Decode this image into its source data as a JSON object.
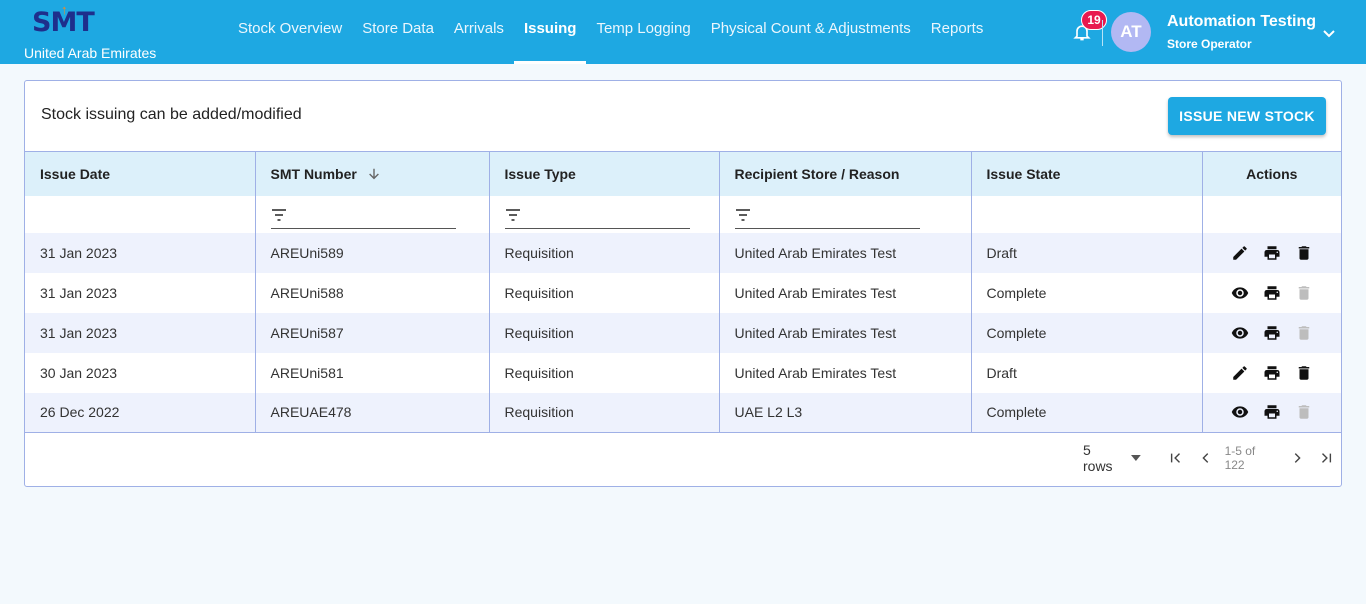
{
  "header": {
    "logo_text": "SMT",
    "country": "United Arab Emirates",
    "nav": [
      {
        "label": "Stock Overview",
        "active": false
      },
      {
        "label": "Store Data",
        "active": false
      },
      {
        "label": "Arrivals",
        "active": false
      },
      {
        "label": "Issuing",
        "active": true
      },
      {
        "label": "Temp Logging",
        "active": false
      },
      {
        "label": "Physical Count & Adjustments",
        "active": false
      },
      {
        "label": "Reports",
        "active": false
      }
    ],
    "notifications": "19",
    "avatar_initials": "AT",
    "user_name": "Automation Testing",
    "user_role": "Store Operator"
  },
  "page": {
    "title": "Stock issuing can be added/modified",
    "issue_button": "ISSUE NEW STOCK"
  },
  "table": {
    "columns": [
      "Issue Date",
      "SMT Number",
      "Issue Type",
      "Recipient Store / Reason",
      "Issue State",
      "Actions"
    ],
    "rows": [
      {
        "date": "31 Jan 2023",
        "number": "AREUni589",
        "type": "Requisition",
        "recipient": "United Arab Emirates Test",
        "state": "Draft",
        "actions": [
          "edit",
          "print",
          "delete"
        ],
        "delete_enabled": true
      },
      {
        "date": "31 Jan 2023",
        "number": "AREUni588",
        "type": "Requisition",
        "recipient": "United Arab Emirates Test",
        "state": "Complete",
        "actions": [
          "view",
          "print",
          "delete"
        ],
        "delete_enabled": false
      },
      {
        "date": "31 Jan 2023",
        "number": "AREUni587",
        "type": "Requisition",
        "recipient": "United Arab Emirates Test",
        "state": "Complete",
        "actions": [
          "view",
          "print",
          "delete"
        ],
        "delete_enabled": false
      },
      {
        "date": "30 Jan 2023",
        "number": "AREUni581",
        "type": "Requisition",
        "recipient": "United Arab Emirates Test",
        "state": "Draft",
        "actions": [
          "edit",
          "print",
          "delete"
        ],
        "delete_enabled": true
      },
      {
        "date": "26 Dec 2022",
        "number": "AREUAE478",
        "type": "Requisition",
        "recipient": "UAE L2 L3",
        "state": "Complete",
        "actions": [
          "view",
          "print",
          "delete"
        ],
        "delete_enabled": false
      }
    ]
  },
  "pagination": {
    "rows_label": "5 rows",
    "range": "1-5 of 122"
  },
  "colors": {
    "primary": "#1ea8e2",
    "brand_dark": "#1e2f8c",
    "badge": "#e8194f",
    "avatar": "#b2b8f3"
  }
}
